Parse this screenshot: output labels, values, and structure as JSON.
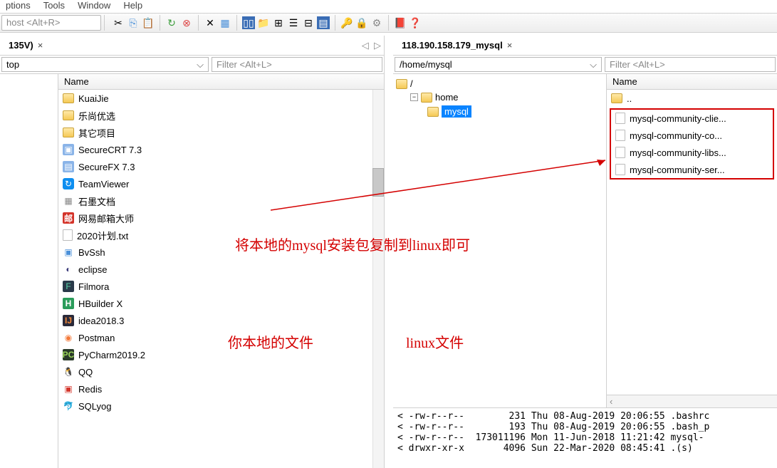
{
  "menu": [
    "ptions",
    "Tools",
    "Window",
    "Help"
  ],
  "host_placeholder": "host <Alt+R>",
  "left": {
    "tab": "135V)",
    "path": "top",
    "filter": "Filter <Alt+L>",
    "header": "Name",
    "items": [
      {
        "name": "KuaiJie",
        "ico": "folder"
      },
      {
        "name": "乐尚优选",
        "ico": "folder"
      },
      {
        "name": "其它项目",
        "ico": "folder"
      },
      {
        "name": "SecureCRT 7.3",
        "ico": "app1"
      },
      {
        "name": "SecureFX 7.3",
        "ico": "app2"
      },
      {
        "name": "TeamViewer",
        "ico": "tv"
      },
      {
        "name": "石墨文档",
        "ico": "app3"
      },
      {
        "name": "网易邮箱大师",
        "ico": "mail"
      },
      {
        "name": "2020计划.txt",
        "ico": "txt"
      },
      {
        "name": "BvSsh",
        "ico": "ssh"
      },
      {
        "name": "eclipse",
        "ico": "ec"
      },
      {
        "name": "Filmora",
        "ico": "fm"
      },
      {
        "name": "HBuilder X",
        "ico": "hb"
      },
      {
        "name": "idea2018.3",
        "ico": "ij"
      },
      {
        "name": "Postman",
        "ico": "pm"
      },
      {
        "name": "PyCharm2019.2",
        "ico": "pc"
      },
      {
        "name": "QQ",
        "ico": "qq"
      },
      {
        "name": "Redis",
        "ico": "rd"
      },
      {
        "name": "SQLyog",
        "ico": "sq"
      }
    ]
  },
  "right": {
    "tab": "118.190.158.179_mysql",
    "path": "/home/mysql",
    "filter": "Filter <Alt+L>",
    "header": "Name",
    "tree": {
      "root": "/",
      "child1": "home",
      "child2": "mysql"
    },
    "items": [
      {
        "name": "..",
        "ico": "folder"
      },
      {
        "name": "mysql-community-clie...",
        "ico": "doc"
      },
      {
        "name": "mysql-community-co...",
        "ico": "doc"
      },
      {
        "name": "mysql-community-libs...",
        "ico": "doc"
      },
      {
        "name": "mysql-community-ser...",
        "ico": "doc"
      }
    ],
    "log": "< -rw-r--r--        231 Thu 08-Aug-2019 20:06:55 .bashrc\n< -rw-r--r--        193 Thu 08-Aug-2019 20:06:55 .bash_p\n< -rw-r--r--  173011196 Mon 11-Jun-2018 11:21:42 mysql-\n< drwxr-xr-x       4096 Sun 22-Mar-2020 08:45:41 .(s)"
  },
  "annotations": {
    "a1": "将本地的mysql安装包复制到linux即可",
    "a2": "你本地的文件",
    "a3": "linux文件"
  }
}
